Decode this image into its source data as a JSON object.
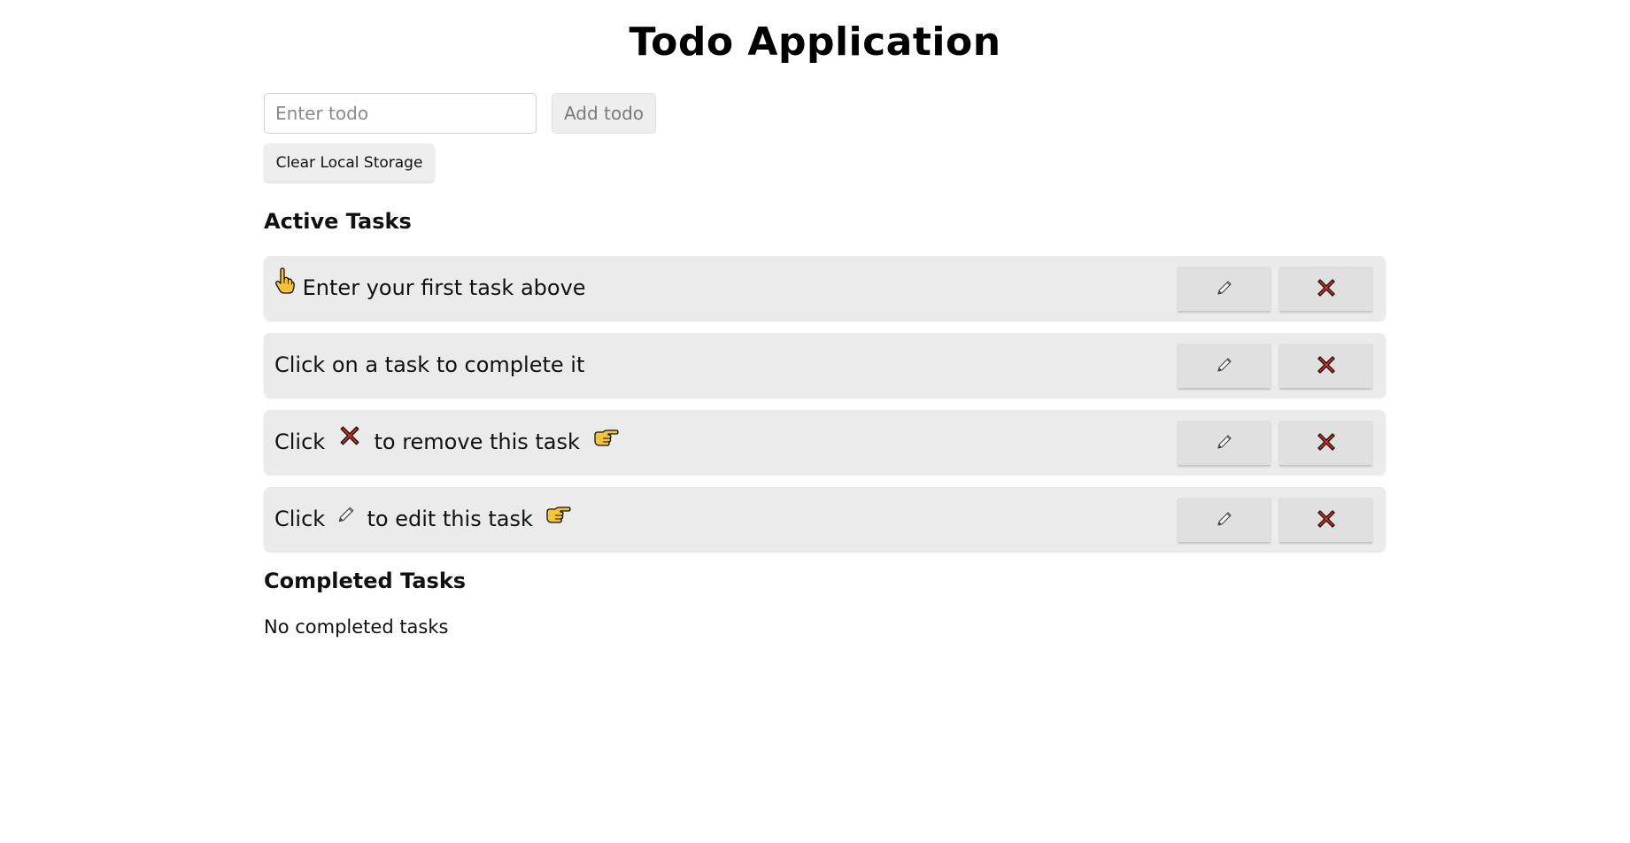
{
  "app": {
    "title": "Todo Application"
  },
  "form": {
    "input_placeholder": "Enter todo",
    "input_value": "",
    "add_label": "Add todo",
    "clear_label": "Clear Local Storage"
  },
  "active": {
    "heading": "Active Tasks",
    "tasks": [
      {
        "before": "",
        "icon1": "pointing-up-hand-icon",
        "middle": "Enter your first task above",
        "icon2": "",
        "after": ""
      },
      {
        "before": "",
        "icon1": "",
        "middle": "Click on a task to complete it",
        "icon2": "",
        "after": ""
      },
      {
        "before": "Click",
        "icon1": "cross-mark-icon",
        "middle": "to remove this task",
        "icon2": "pointing-right-hand-icon",
        "after": ""
      },
      {
        "before": "Click",
        "icon1": "pencil-icon",
        "middle": "to edit this task",
        "icon2": "pointing-right-hand-icon",
        "after": ""
      }
    ],
    "row_actions": {
      "edit_icon": "pencil-icon",
      "delete_icon": "cross-mark-icon"
    }
  },
  "completed": {
    "heading": "Completed Tasks",
    "empty_text": "No completed tasks"
  },
  "colors": {
    "row_background": "#ebebeb",
    "button_background": "#e0e0e0",
    "cross_red": "#d8372a",
    "hand_yellow": "#f5c33b"
  }
}
